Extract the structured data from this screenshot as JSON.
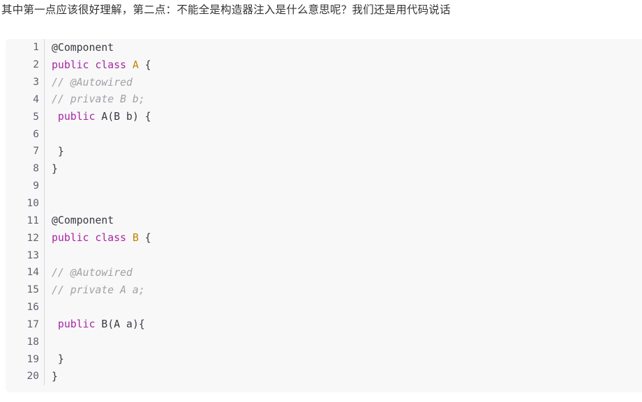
{
  "intro": {
    "text": "其中第一点应该很好理解，第二点：不能全是构造器注入是什么意思呢？我们还是用代码说话"
  },
  "code_block": {
    "language": "java",
    "background_color": "#f8f8f8",
    "gutter_divider_color": "#d8d8d8",
    "colors": {
      "keyword": "#a626a4",
      "type": "#c18401",
      "comment": "#a0a1a7",
      "plain": "#383a42",
      "lineno": "#5c6370"
    },
    "lines": [
      {
        "n": "1",
        "tokens": [
          {
            "t": "@Component",
            "c": "plain"
          }
        ]
      },
      {
        "n": "2",
        "tokens": [
          {
            "t": "public class ",
            "c": "kw"
          },
          {
            "t": "A",
            "c": "type"
          },
          {
            "t": " {",
            "c": "plain"
          }
        ]
      },
      {
        "n": "3",
        "tokens": [
          {
            "t": "// @Autowired",
            "c": "comment"
          }
        ]
      },
      {
        "n": "4",
        "tokens": [
          {
            "t": "// private B b;",
            "c": "comment"
          }
        ]
      },
      {
        "n": "5",
        "tokens": [
          {
            "t": " ",
            "c": "plain"
          },
          {
            "t": "public",
            "c": "kw"
          },
          {
            "t": " A(B b) {",
            "c": "plain"
          }
        ]
      },
      {
        "n": "6",
        "tokens": []
      },
      {
        "n": "7",
        "tokens": [
          {
            "t": " }",
            "c": "plain"
          }
        ]
      },
      {
        "n": "8",
        "tokens": [
          {
            "t": "}",
            "c": "plain"
          }
        ]
      },
      {
        "n": "9",
        "tokens": []
      },
      {
        "n": "10",
        "tokens": []
      },
      {
        "n": "11",
        "tokens": [
          {
            "t": "@Component",
            "c": "plain"
          }
        ]
      },
      {
        "n": "12",
        "tokens": [
          {
            "t": "public class ",
            "c": "kw"
          },
          {
            "t": "B",
            "c": "type"
          },
          {
            "t": " {",
            "c": "plain"
          }
        ]
      },
      {
        "n": "13",
        "tokens": []
      },
      {
        "n": "14",
        "tokens": [
          {
            "t": "// @Autowired",
            "c": "comment"
          }
        ]
      },
      {
        "n": "15",
        "tokens": [
          {
            "t": "// private A a;",
            "c": "comment"
          }
        ]
      },
      {
        "n": "16",
        "tokens": []
      },
      {
        "n": "17",
        "tokens": [
          {
            "t": " ",
            "c": "plain"
          },
          {
            "t": "public",
            "c": "kw"
          },
          {
            "t": " B(A a){",
            "c": "plain"
          }
        ]
      },
      {
        "n": "18",
        "tokens": []
      },
      {
        "n": "19",
        "tokens": [
          {
            "t": " }",
            "c": "plain"
          }
        ]
      },
      {
        "n": "20",
        "tokens": [
          {
            "t": "}",
            "c": "plain"
          }
        ]
      }
    ]
  }
}
